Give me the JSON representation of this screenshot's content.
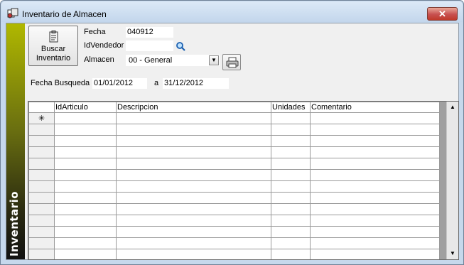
{
  "window": {
    "title": "Inventario de Almacen",
    "close_label": "✕"
  },
  "sidebar": {
    "label": "Inventario"
  },
  "toolbar": {
    "buscar_label": "Buscar\nInventario"
  },
  "form": {
    "fecha_label": "Fecha",
    "fecha_value": "040912",
    "vendedor_label": "IdVendedor",
    "vendedor_value": "",
    "almacen_label": "Almacen",
    "almacen_value": "00 - General",
    "busqueda_label": "Fecha Busqueda",
    "desde_value": "01/01/2012",
    "a_label": "a",
    "hasta_value": "31/12/2012"
  },
  "grid": {
    "columns": [
      "",
      "IdArticulo",
      "Descripcion",
      "Unidades",
      "Comentario"
    ],
    "new_row_marker": "✳",
    "rows": [
      [
        "✳",
        "",
        "",
        "",
        ""
      ],
      [
        "",
        "",
        "",
        "",
        ""
      ],
      [
        "",
        "",
        "",
        "",
        ""
      ],
      [
        "",
        "",
        "",
        "",
        ""
      ],
      [
        "",
        "",
        "",
        "",
        ""
      ],
      [
        "",
        "",
        "",
        "",
        ""
      ],
      [
        "",
        "",
        "",
        "",
        ""
      ],
      [
        "",
        "",
        "",
        "",
        ""
      ],
      [
        "",
        "",
        "",
        "",
        ""
      ],
      [
        "",
        "",
        "",
        "",
        ""
      ],
      [
        "",
        "",
        "",
        "",
        ""
      ],
      [
        "",
        "",
        "",
        "",
        ""
      ],
      [
        "",
        "",
        "",
        "",
        ""
      ]
    ]
  },
  "scrollbar": {
    "up": "▲",
    "down": "▼"
  }
}
